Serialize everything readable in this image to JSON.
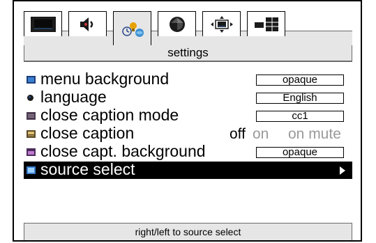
{
  "tabs": [
    {
      "icon": "monitor-icon",
      "active": false
    },
    {
      "icon": "speaker-icon",
      "active": false
    },
    {
      "icon": "settings-tools-icon",
      "active": true
    },
    {
      "icon": "brightness-icon",
      "active": false
    },
    {
      "icon": "position-icon",
      "active": false
    },
    {
      "icon": "pip-icon",
      "active": false
    }
  ],
  "title": "settings",
  "menu": {
    "menu_background": {
      "label": "menu background",
      "value": "opaque"
    },
    "language": {
      "label": "language",
      "value": "English"
    },
    "close_caption_mode": {
      "label": "close caption mode",
      "value": "cc1"
    },
    "close_caption": {
      "label": "close caption",
      "options": [
        "off",
        "on",
        "on mute"
      ],
      "selected": "off"
    },
    "close_capt_background": {
      "label": "close capt. background",
      "value": "opaque"
    },
    "source_select": {
      "label": "source select",
      "selected": true
    }
  },
  "help": "right/left to source select",
  "colors": {
    "selected_row": "#000000",
    "panel_gray": "#e6e6e6",
    "inactive_option": "#9a9a9a"
  }
}
